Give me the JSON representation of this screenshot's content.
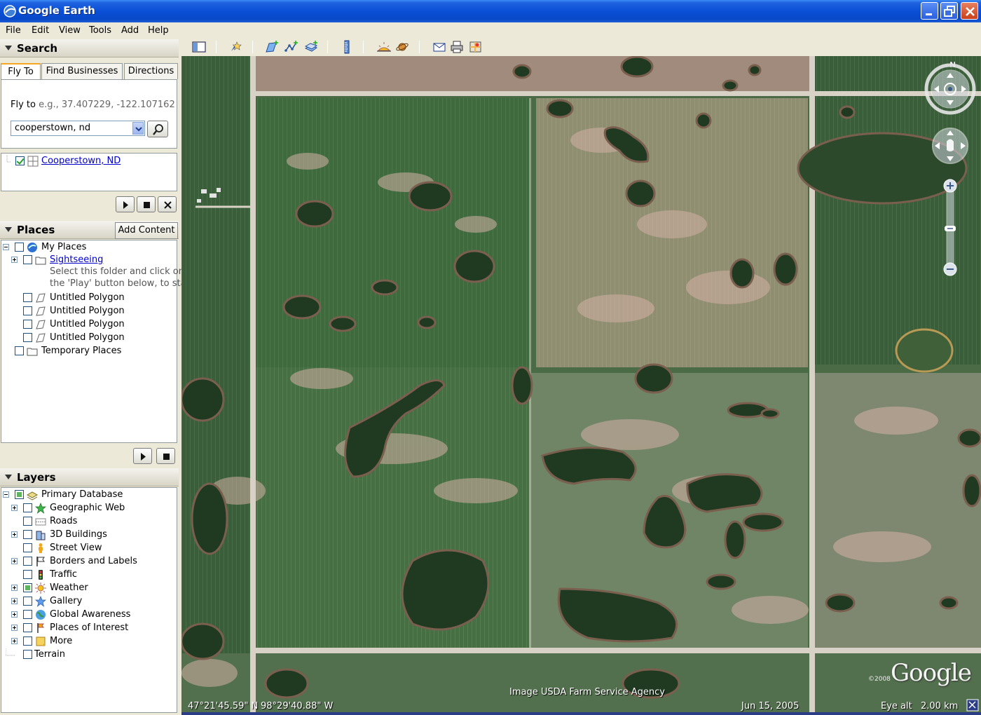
{
  "window": {
    "title": "Google Earth"
  },
  "menu": [
    "File",
    "Edit",
    "View",
    "Tools",
    "Add",
    "Help"
  ],
  "search": {
    "header": "Search",
    "tabs": [
      "Fly To",
      "Find Businesses",
      "Directions"
    ],
    "fly_to_label": "Fly to",
    "fly_to_hint": "e.g., 37.407229, -122.107162",
    "query": "cooperstown, nd",
    "result": "Cooperstown, ND"
  },
  "places": {
    "header": "Places",
    "add_content": "Add Content",
    "items": [
      {
        "label": "My Places"
      },
      {
        "label": "Sightseeing"
      },
      {
        "label": "Select this folder and click on"
      },
      {
        "label": "the 'Play' button below, to start"
      },
      {
        "label": "Untitled Polygon"
      },
      {
        "label": "Untitled Polygon"
      },
      {
        "label": "Untitled Polygon"
      },
      {
        "label": "Untitled Polygon"
      },
      {
        "label": "Temporary Places"
      }
    ]
  },
  "layers": {
    "header": "Layers",
    "items": [
      {
        "label": "Primary Database"
      },
      {
        "label": "Geographic Web"
      },
      {
        "label": "Roads"
      },
      {
        "label": "3D Buildings"
      },
      {
        "label": "Street View"
      },
      {
        "label": "Borders and Labels"
      },
      {
        "label": "Traffic"
      },
      {
        "label": "Weather"
      },
      {
        "label": "Gallery"
      },
      {
        "label": "Global Awareness"
      },
      {
        "label": "Places of Interest"
      },
      {
        "label": "More"
      },
      {
        "label": "Terrain"
      }
    ]
  },
  "map": {
    "latitude": "47°21'45.59\" N",
    "longitude": "98°29'40.88\" W",
    "imagery_credit": "Image USDA Farm Service Agency",
    "imagery_date": "Jun 15, 2005",
    "eye_alt_label": "Eye alt",
    "eye_alt_value": "2.00 km",
    "copyright": "©2008",
    "logo": "Google",
    "compass_north": "N"
  },
  "colors": {
    "titlebar": "#0a4fd6",
    "field_green": "#3f6a3e",
    "field_pink": "#b59a8a",
    "road": "#d8d2c6"
  }
}
